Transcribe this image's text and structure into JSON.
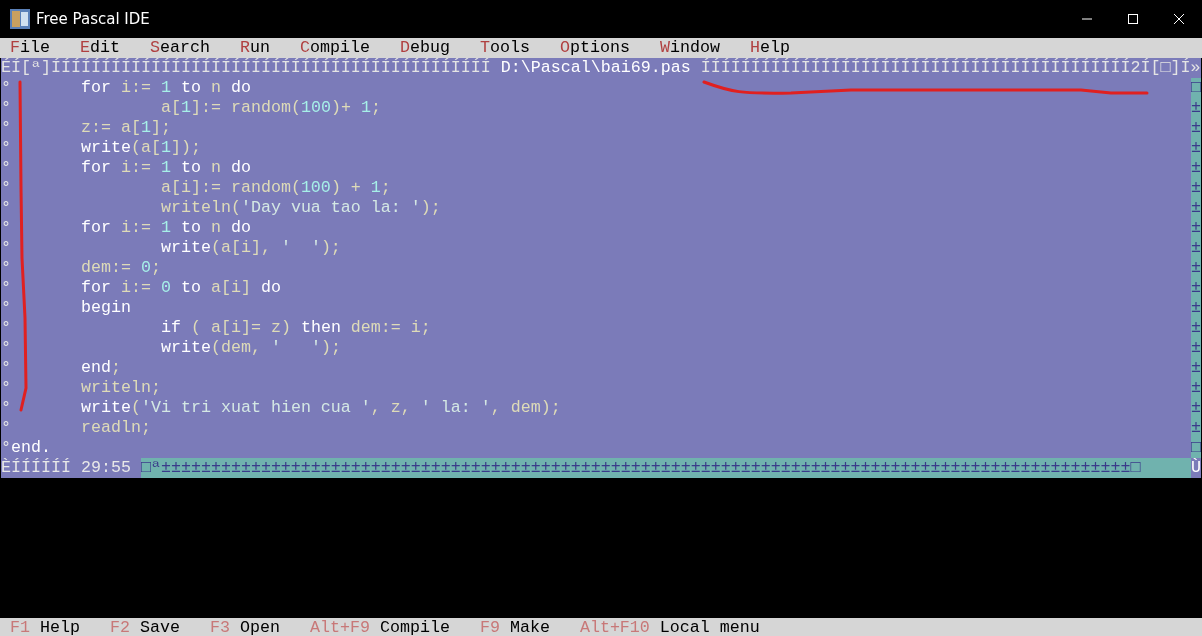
{
  "window": {
    "title": "Free Pascal IDE"
  },
  "menu": [
    {
      "label": "File"
    },
    {
      "label": "Edit"
    },
    {
      "label": "Search"
    },
    {
      "label": "Run"
    },
    {
      "label": "Compile"
    },
    {
      "label": "Debug"
    },
    {
      "label": "Tools"
    },
    {
      "label": "Options"
    },
    {
      "label": "Window"
    },
    {
      "label": "Help"
    }
  ],
  "editor": {
    "frame_left": "ÉÍ[ª]ÍÍÍÍÍÍÍÍÍÍÍÍÍÍÍÍÍÍÍÍÍÍÍÍÍÍÍÍÍÍÍÍÍÍÍÍÍÍÍÍÍÍÍÍ",
    "file_title": "D:\\Pascal\\bai69.pas",
    "frame_right": "ÍÍÍÍÍÍÍÍÍÍÍÍÍÍÍÍÍÍÍÍÍÍÍÍÍÍÍÍÍÍÍÍÍÍÍÍÍÍÍÍÍÍÍ2Í[□]Í»",
    "lines": [
      [
        {
          "t": "°       ",
          "kind": "frame"
        },
        {
          "t": "for",
          "kind": "kw"
        },
        {
          "t": " i:= ",
          "kind": "id"
        },
        {
          "t": "1",
          "kind": "num"
        },
        {
          "t": " to",
          "kind": "kw"
        },
        {
          "t": " n ",
          "kind": "id"
        },
        {
          "t": "do",
          "kind": "kw"
        }
      ],
      [
        {
          "t": "°               ",
          "kind": "frame"
        },
        {
          "t": "a[",
          "kind": "id"
        },
        {
          "t": "1",
          "kind": "num"
        },
        {
          "t": "]:= random(",
          "kind": "id"
        },
        {
          "t": "100",
          "kind": "num"
        },
        {
          "t": ")+ ",
          "kind": "id"
        },
        {
          "t": "1",
          "kind": "num"
        },
        {
          "t": ";",
          "kind": "id"
        }
      ],
      [
        {
          "t": "°       ",
          "kind": "frame"
        },
        {
          "t": "z:= a[",
          "kind": "id"
        },
        {
          "t": "1",
          "kind": "num"
        },
        {
          "t": "];",
          "kind": "id"
        }
      ],
      [
        {
          "t": "°       ",
          "kind": "frame"
        },
        {
          "t": "write",
          "kind": "kw"
        },
        {
          "t": "(a[",
          "kind": "id"
        },
        {
          "t": "1",
          "kind": "num"
        },
        {
          "t": "]);",
          "kind": "id"
        }
      ],
      [
        {
          "t": "°       ",
          "kind": "frame"
        },
        {
          "t": "for",
          "kind": "kw"
        },
        {
          "t": " i:= ",
          "kind": "id"
        },
        {
          "t": "1",
          "kind": "num"
        },
        {
          "t": " to",
          "kind": "kw"
        },
        {
          "t": " n ",
          "kind": "id"
        },
        {
          "t": "do",
          "kind": "kw"
        }
      ],
      [
        {
          "t": "°               ",
          "kind": "frame"
        },
        {
          "t": "a[i]:= random(",
          "kind": "id"
        },
        {
          "t": "100",
          "kind": "num"
        },
        {
          "t": ") + ",
          "kind": "id"
        },
        {
          "t": "1",
          "kind": "num"
        },
        {
          "t": ";",
          "kind": "id"
        }
      ],
      [
        {
          "t": "°               ",
          "kind": "frame"
        },
        {
          "t": "writeln(",
          "kind": "id"
        },
        {
          "t": "'Day vua tao la: '",
          "kind": "str"
        },
        {
          "t": ");",
          "kind": "id"
        }
      ],
      [
        {
          "t": "°       ",
          "kind": "frame"
        },
        {
          "t": "for",
          "kind": "kw"
        },
        {
          "t": " i:= ",
          "kind": "id"
        },
        {
          "t": "1",
          "kind": "num"
        },
        {
          "t": " to",
          "kind": "kw"
        },
        {
          "t": " n ",
          "kind": "id"
        },
        {
          "t": "do",
          "kind": "kw"
        }
      ],
      [
        {
          "t": "°               ",
          "kind": "frame"
        },
        {
          "t": "write",
          "kind": "kw"
        },
        {
          "t": "(a[i], ",
          "kind": "id"
        },
        {
          "t": "'  '",
          "kind": "str"
        },
        {
          "t": ");",
          "kind": "id"
        }
      ],
      [
        {
          "t": "°       ",
          "kind": "frame"
        },
        {
          "t": "dem:= ",
          "kind": "id"
        },
        {
          "t": "0",
          "kind": "num"
        },
        {
          "t": ";",
          "kind": "id"
        }
      ],
      [
        {
          "t": "°       ",
          "kind": "frame"
        },
        {
          "t": "for",
          "kind": "kw"
        },
        {
          "t": " i:= ",
          "kind": "id"
        },
        {
          "t": "0",
          "kind": "num"
        },
        {
          "t": " to",
          "kind": "kw"
        },
        {
          "t": " a[i] ",
          "kind": "id"
        },
        {
          "t": "do",
          "kind": "kw"
        }
      ],
      [
        {
          "t": "°       ",
          "kind": "frame"
        },
        {
          "t": "begin",
          "kind": "kw"
        }
      ],
      [
        {
          "t": "°               ",
          "kind": "frame"
        },
        {
          "t": "if",
          "kind": "kw"
        },
        {
          "t": " ( a[i]= z) ",
          "kind": "id"
        },
        {
          "t": "then",
          "kind": "kw"
        },
        {
          "t": " dem:= i;",
          "kind": "id"
        }
      ],
      [
        {
          "t": "°               ",
          "kind": "frame"
        },
        {
          "t": "write",
          "kind": "kw"
        },
        {
          "t": "(dem, ",
          "kind": "id"
        },
        {
          "t": "'   '",
          "kind": "str"
        },
        {
          "t": ");",
          "kind": "id"
        }
      ],
      [
        {
          "t": "°       ",
          "kind": "frame"
        },
        {
          "t": "end",
          "kind": "kw"
        },
        {
          "t": ";",
          "kind": "id"
        }
      ],
      [
        {
          "t": "°       ",
          "kind": "frame"
        },
        {
          "t": "writeln;",
          "kind": "id"
        }
      ],
      [
        {
          "t": "°       ",
          "kind": "frame"
        },
        {
          "t": "write",
          "kind": "kw"
        },
        {
          "t": "(",
          "kind": "id"
        },
        {
          "t": "'Vi tri xuat hien cua '",
          "kind": "str"
        },
        {
          "t": ", z, ",
          "kind": "id"
        },
        {
          "t": "' la: '",
          "kind": "str"
        },
        {
          "t": ", dem);",
          "kind": "id"
        }
      ],
      [
        {
          "t": "°       ",
          "kind": "frame"
        },
        {
          "t": "readln;",
          "kind": "id"
        }
      ],
      [
        {
          "t": "°",
          "kind": "frame"
        },
        {
          "t": "end.",
          "kind": "kw"
        }
      ]
    ],
    "vscroll": "□±±±±±±±±±±±±±±±±±□",
    "frame_bottom": "ÈÍÍÍÍÍÍ 29:55 ",
    "hscroll": "□ª±±±±±±±±±±±±±±±±±±±±±±±±±±±±±±±±±±±±±±±±±±±±±±±±±±±±±±±±±±±±±±±±±±±±±±±±±±±±±±±±±±±±±±±±±±±±±±±±±□",
    "corner": "Ù"
  },
  "status_bar": [
    {
      "key": "F1",
      "label": "Help"
    },
    {
      "key": "F2",
      "label": "Save"
    },
    {
      "key": "F3",
      "label": "Open"
    },
    {
      "key": "Alt+F9",
      "label": "Compile"
    },
    {
      "key": "F9",
      "label": "Make"
    },
    {
      "key": "Alt+F10",
      "label": "Local menu"
    }
  ]
}
